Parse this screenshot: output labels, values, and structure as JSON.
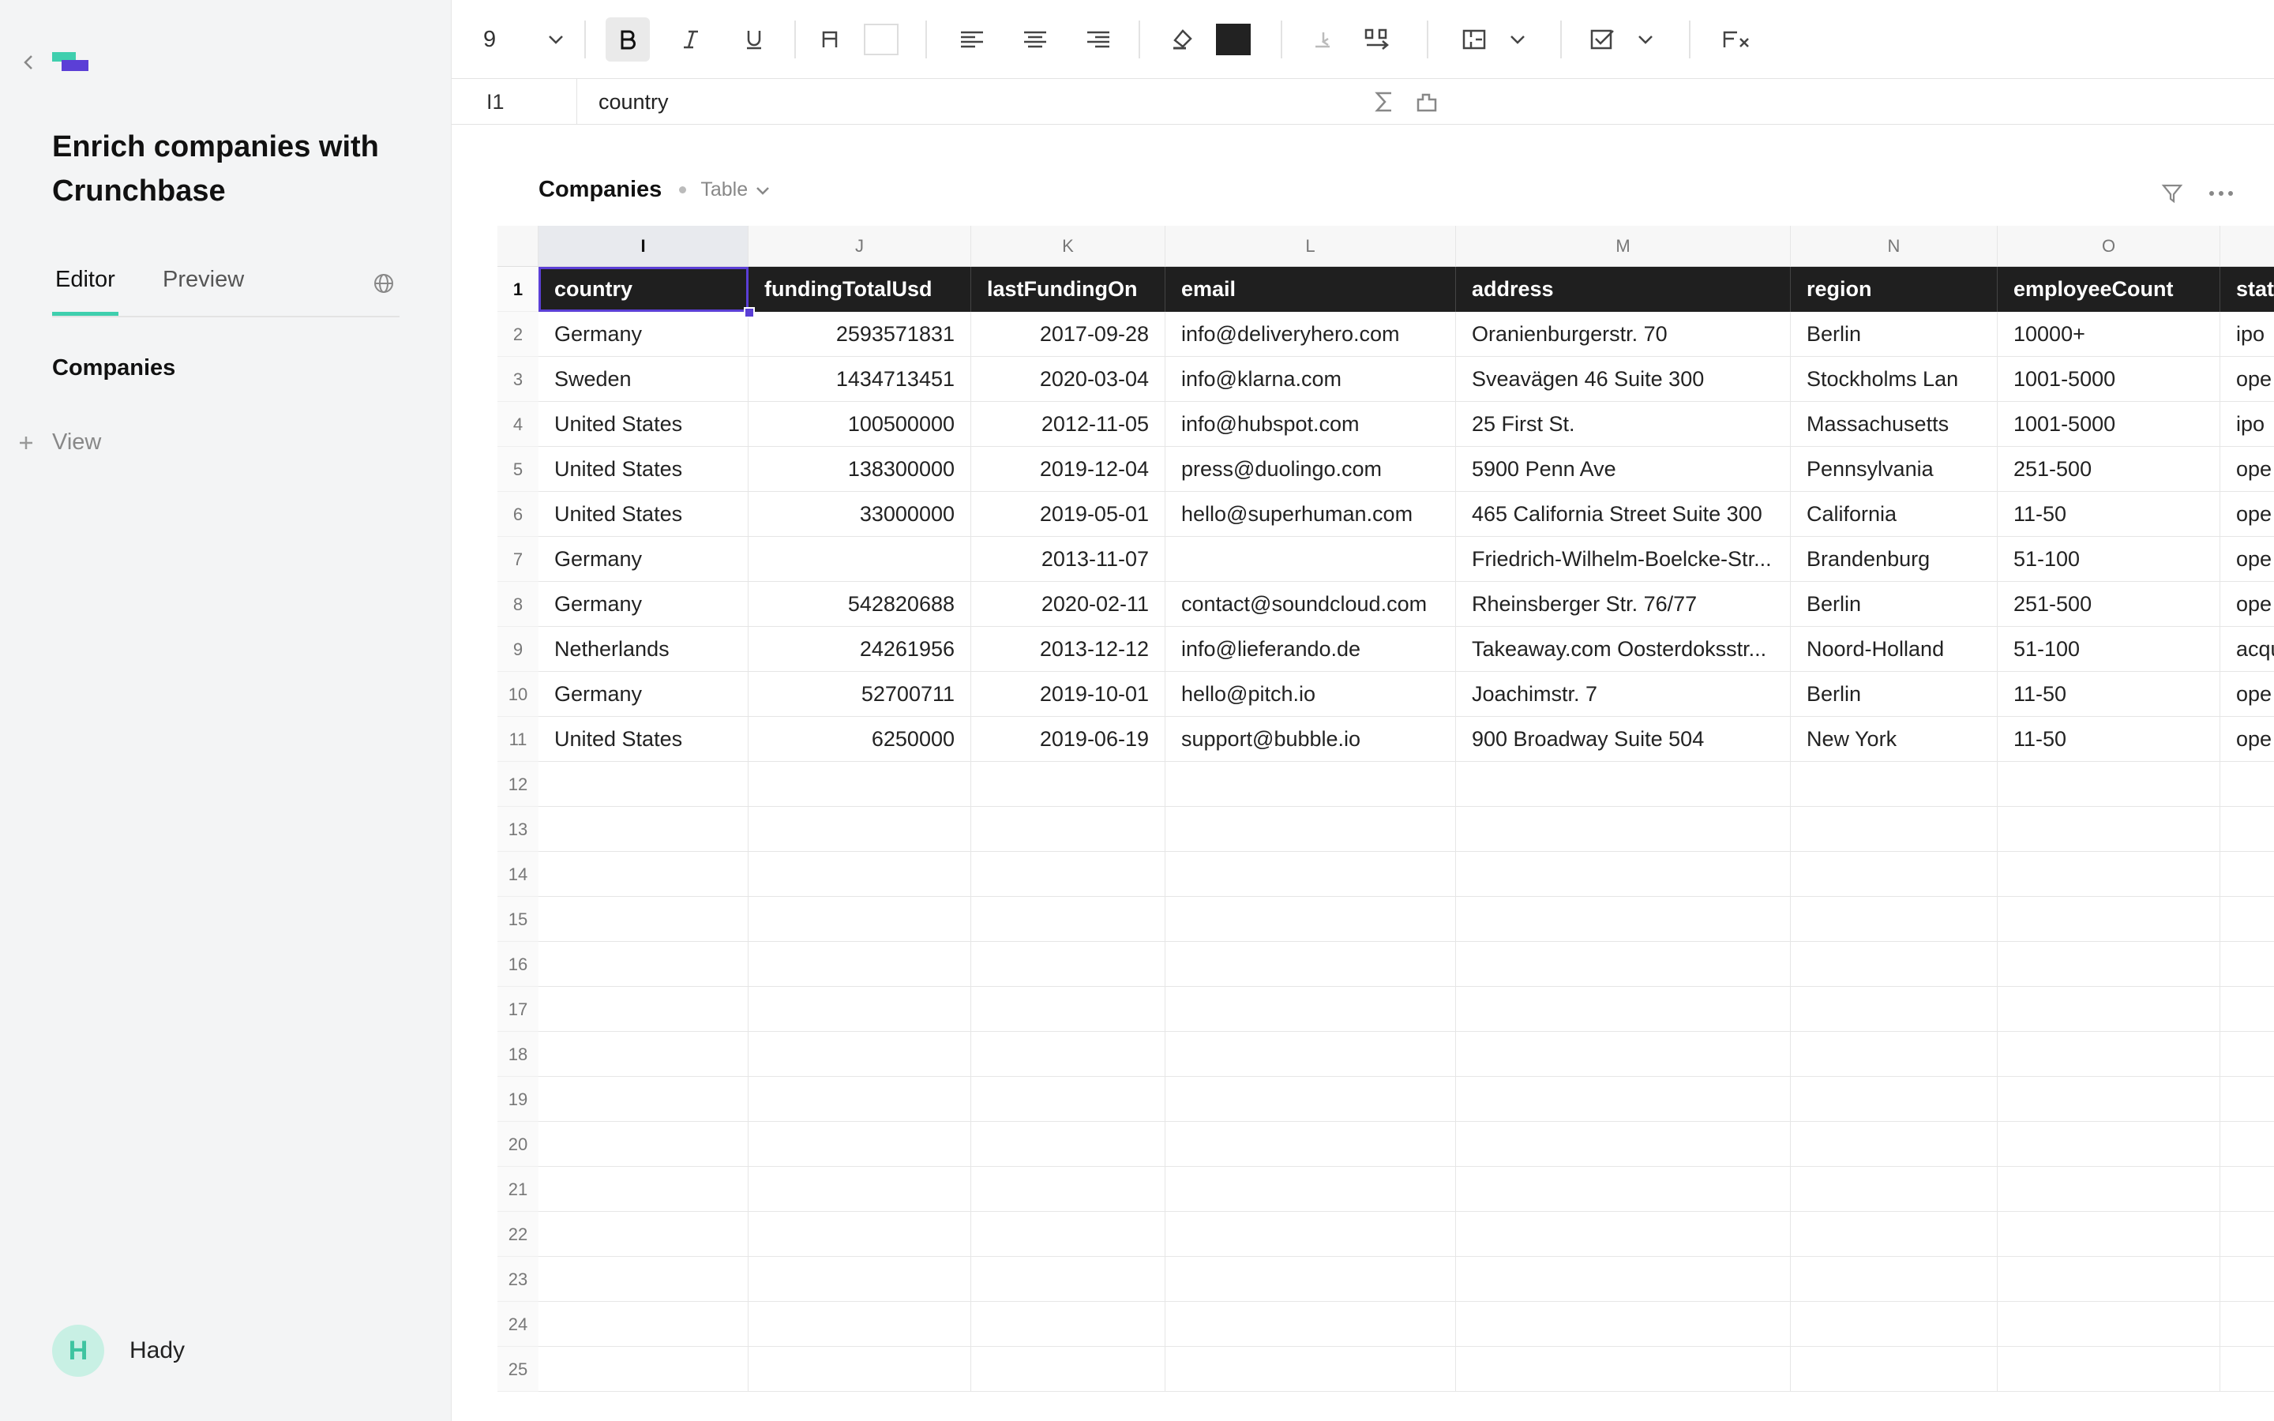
{
  "sidebar": {
    "doc_title": "Enrich companies with Crunchbase",
    "tabs": [
      {
        "label": "Editor",
        "active": true
      },
      {
        "label": "Preview",
        "active": false
      }
    ],
    "section_label": "Companies",
    "add_view_label": "View",
    "user": {
      "initial": "H",
      "name": "Hady",
      "avatar_color": "#3fc4a0"
    },
    "accent_color": "#3fcfae"
  },
  "toolbar": {
    "font_size": "9",
    "buttons": [
      "chevron-down-icon",
      "bold-icon",
      "italic-icon",
      "underline-icon",
      "font-color-icon",
      "font-color-swatch",
      "align-left-icon",
      "align-center-icon",
      "align-right-icon",
      "fill-color-icon",
      "fill-color-swatch",
      "indent-left-icon",
      "wrap-icon",
      "merge-icon",
      "checkbox-icon",
      "clear-format-icon"
    ]
  },
  "formula_bar": {
    "cell_ref": "I1",
    "value": "country"
  },
  "table": {
    "title": "Companies",
    "view_label": "Table",
    "selection_color": "#5b3fd6",
    "column_letters": [
      "I",
      "J",
      "K",
      "L",
      "M",
      "N",
      "O"
    ],
    "headers": [
      "country",
      "fundingTotalUsd",
      "lastFundingOn",
      "email",
      "address",
      "region",
      "employeeCount",
      "stat"
    ],
    "rows": [
      [
        "Germany",
        "2593571831",
        "2017-09-28",
        "info@deliveryhero.com",
        "Oranienburgerstr. 70",
        "Berlin",
        "10000+",
        "ipo"
      ],
      [
        "Sweden",
        "1434713451",
        "2020-03-04",
        "info@klarna.com",
        "Sveavägen 46 Suite 300",
        "Stockholms Lan",
        "1001-5000",
        "ope"
      ],
      [
        "United States",
        "100500000",
        "2012-11-05",
        "info@hubspot.com",
        "25 First St.",
        "Massachusetts",
        "1001-5000",
        "ipo"
      ],
      [
        "United States",
        "138300000",
        "2019-12-04",
        "press@duolingo.com",
        "5900 Penn Ave",
        "Pennsylvania",
        "251-500",
        "ope"
      ],
      [
        "United States",
        "33000000",
        "2019-05-01",
        "hello@superhuman.com",
        "465 California Street Suite 300",
        "California",
        "11-50",
        "ope"
      ],
      [
        "Germany",
        "",
        "2013-11-07",
        "",
        "Friedrich-Wilhelm-Boelcke-Str...",
        "Brandenburg",
        "51-100",
        "ope"
      ],
      [
        "Germany",
        "542820688",
        "2020-02-11",
        "contact@soundcloud.com",
        "Rheinsberger Str. 76/77",
        "Berlin",
        "251-500",
        "ope"
      ],
      [
        "Netherlands",
        "24261956",
        "2013-12-12",
        "info@lieferando.de",
        "Takeaway.com Oosterdoksstr...",
        "Noord-Holland",
        "51-100",
        "acqu"
      ],
      [
        "Germany",
        "52700711",
        "2019-10-01",
        "hello@pitch.io",
        "Joachimstr. 7",
        "Berlin",
        "11-50",
        "ope"
      ],
      [
        "United States",
        "6250000",
        "2019-06-19",
        "support@bubble.io",
        "900 Broadway Suite 504",
        "New York",
        "11-50",
        "ope"
      ]
    ],
    "row_numbers": [
      "1",
      "2",
      "3",
      "4",
      "5",
      "6",
      "7",
      "8",
      "9",
      "10",
      "11",
      "12",
      "13",
      "14",
      "15",
      "16",
      "17",
      "18",
      "19",
      "20",
      "21",
      "22",
      "23",
      "24",
      "25"
    ]
  }
}
